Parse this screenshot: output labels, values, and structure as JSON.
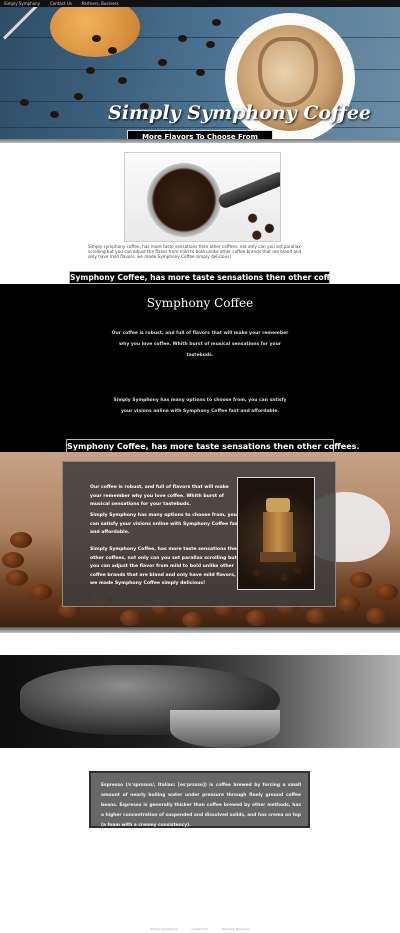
{
  "nav": {
    "items": [
      "Simply Symphony",
      "Contact Us",
      "Partners, Business"
    ]
  },
  "hero": {
    "title": "Simply Symphony Coffee",
    "subtitle": "More Flavors To Choose From"
  },
  "intro": {
    "text": "Simply symphony coffee, has more taste sensations then other coffees, not only can you set parallax scrolling but you can adjust the flavor from mild to bold unlike other coffee brands that are bland and only have mild flavors, we made Symphony Coffee simply delicious!"
  },
  "banners": {
    "first": "Symphony Coffee, has more taste sensations then other coffees.",
    "second": "Symphony Coffee, has more taste sensations then other coffees."
  },
  "black_section": {
    "heading": "Symphony Coffee",
    "p1": "Our coffee is robust, and full of flavors that will make your remember why you love coffee. Whith burst of musical sensations for your tastebuds.",
    "p2": "Simply Symphony has many options to choose from, you can satisfy your visions online with Symphony  Coffee fast and affordable."
  },
  "beans_panel": {
    "p1": "Our coffee is robust, and full of flavors that will make your remember why you love coffee. Whith burst of musical sensations for your tastebuds.",
    "p2": "Simply Symphony has many options to choose from, you can satisfy your visions online with Symphony  Coffee fast and affordable.",
    "p3": "Simply Symphony Coffee, has more taste sensations then other coffees, not only can you set parallax scrolling but you can adjust the flavor from mild to bold unlike other coffee brands that are bland and only have mild flavors, we made Symphony Coffee simply delicious!"
  },
  "espresso": {
    "definition": "Espresso (/ɛˈsprɛsoʊ/, Italian: [esˈprɛsso]) is coffee brewed by forcing a small amount of nearly boiling water under pressure through finely ground coffee beans. Espresso is generally thicker than coffee brewed by other methods, has a higher concentration of suspended and dissolved solids, and has crema on top (a foam with a creamy consistency)."
  },
  "footer": {
    "items": [
      "Simply Symphony",
      "Contact Us",
      "Partners, Business"
    ]
  },
  "colors": {
    "accent": "#000000",
    "hero_blue": "#3c617e",
    "panel_grey": "#686868"
  }
}
